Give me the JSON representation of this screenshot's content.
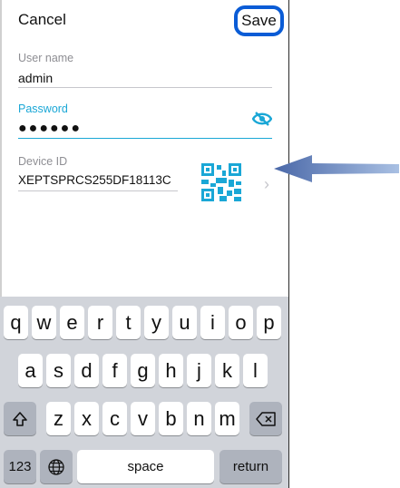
{
  "nav": {
    "cancel": "Cancel",
    "save": "Save"
  },
  "form": {
    "username": {
      "label": "User name",
      "value": "admin"
    },
    "password": {
      "label": "Password",
      "value": "●●●●●●"
    },
    "device": {
      "label": "Device ID",
      "value": "XEPTSPRCS255DF18113C"
    }
  },
  "keyboard": {
    "row1": [
      "q",
      "w",
      "e",
      "r",
      "t",
      "y",
      "u",
      "i",
      "o",
      "p"
    ],
    "row2": [
      "a",
      "s",
      "d",
      "f",
      "g",
      "h",
      "j",
      "k",
      "l"
    ],
    "row3": [
      "z",
      "x",
      "c",
      "v",
      "b",
      "n",
      "m"
    ],
    "numbers": "123",
    "space": "space",
    "return": "return"
  },
  "colors": {
    "accent": "#1aa7d6",
    "save_highlight": "#0a5cd6",
    "arrow": "#5c7eb8"
  },
  "icons": [
    "eye-slash-icon",
    "qr-code-icon",
    "chevron-right-icon",
    "shift-icon",
    "delete-icon",
    "globe-icon",
    "arrow-pointer-icon"
  ]
}
